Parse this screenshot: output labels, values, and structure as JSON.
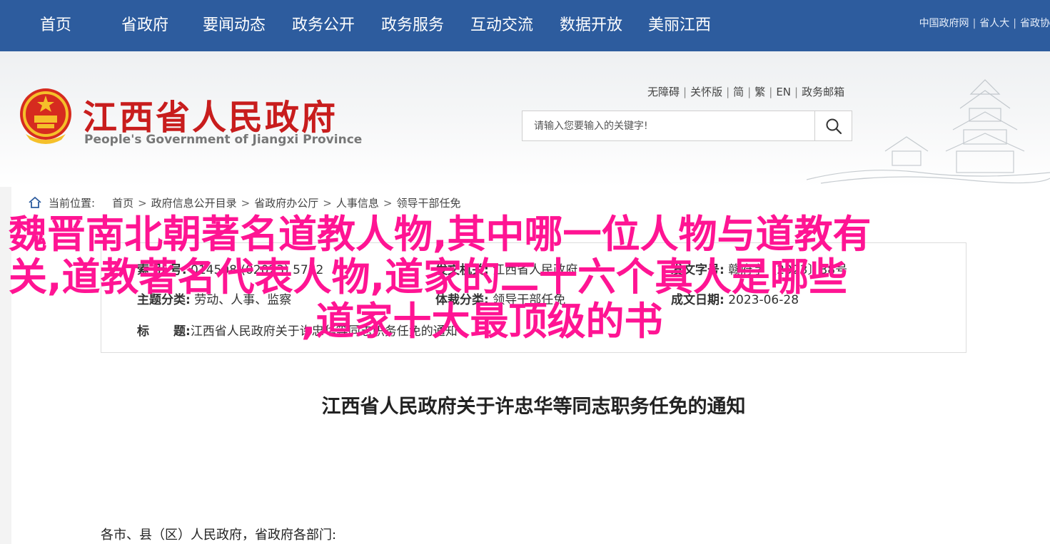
{
  "topnav": {
    "items": [
      "首页",
      "省政府",
      "要闻动态",
      "政务公开",
      "政务服务",
      "互动交流",
      "数据开放",
      "美丽江西"
    ],
    "right_links": [
      "中国政府网",
      "省人大",
      "省政协"
    ]
  },
  "header": {
    "title": "江西省人民政府",
    "subtitle": "People's Government of Jiangxi Province",
    "util_links": [
      "无障碍",
      "关怀版",
      "简",
      "繁",
      "EN",
      "政务邮箱"
    ],
    "search_placeholder": "请输入您要输入的关键字!"
  },
  "breadcrumb": {
    "label": "当前位置:",
    "items": [
      "首页",
      "政府信息公开目录",
      "省政府办公厅",
      "人事信息",
      "领导干部任免"
    ]
  },
  "meta": {
    "index_label": "索 引 号:",
    "index_value": "014508 (02023) 5732",
    "issuer_label": "发文机关:",
    "issuer_value": "江西省人民政府",
    "subject_label": "主题分类:",
    "subject_value": "劳动、人事、监察",
    "form_label": "体裁分类:",
    "form_value": "领导干部任免",
    "docno_label": "发文字号:",
    "docno_value": "赣府字〔2023〕38号",
    "date_label": "成文日期:",
    "date_value": "2023-06-28",
    "title_label": "标　　题:",
    "title_value": "江西省人民政府关于许忠华等同志职务任免的通知"
  },
  "overlay": {
    "line1": "魏晋南北朝著名道教人物,其中哪一位人物与道教有",
    "line2": "关,道教著名代表人物,道家的二十六个真人是哪些",
    "line3": ",道家十大最顶级的书"
  },
  "document": {
    "title": "江西省人民政府关于许忠华等同志职务任免的通知",
    "greeting": "各市、县（区）人民政府，省政府各部门:"
  },
  "colors": {
    "nav_bg": "#2d5c9e",
    "brand_red": "#c81d1d",
    "overlay_pink": "#ff1493"
  }
}
